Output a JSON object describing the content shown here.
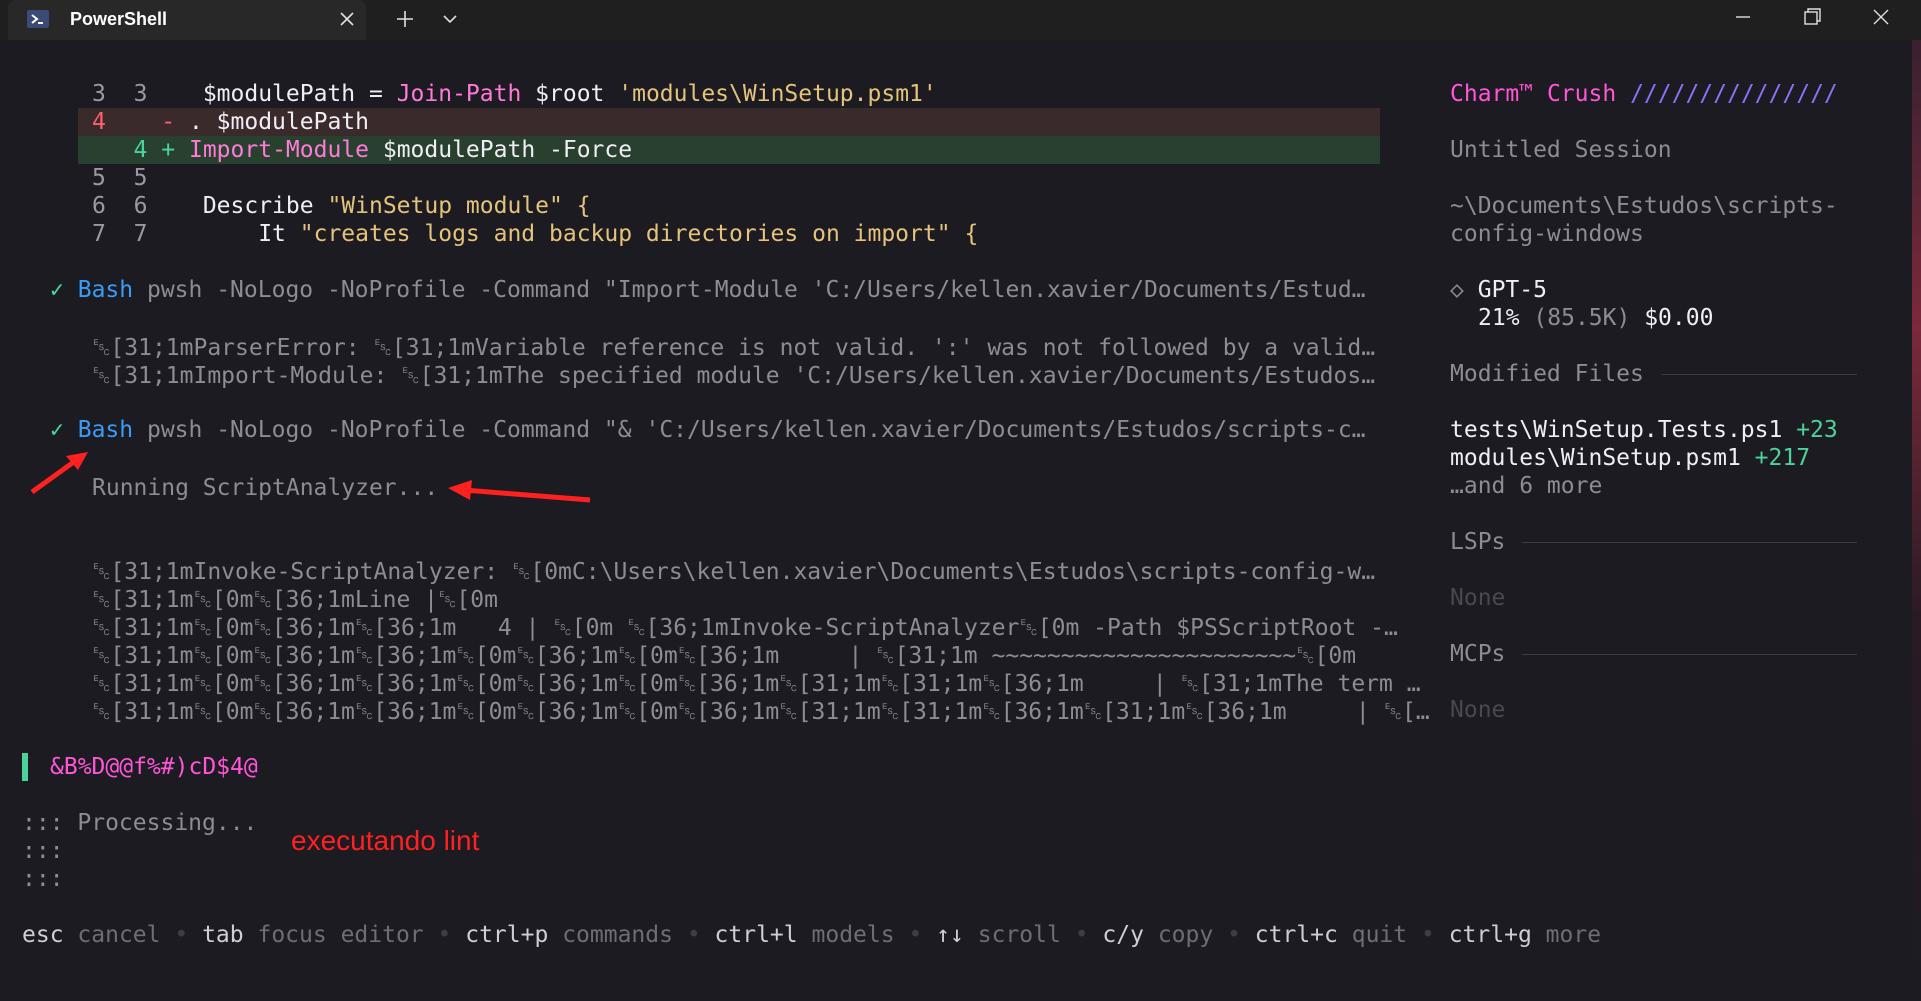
{
  "window": {
    "tab_title": "PowerShell",
    "icon": "powershell-icon"
  },
  "diff": {
    "rows": [
      {
        "old": "3",
        "new": "3",
        "marker": "",
        "code": "$modulePath = Join-Path $root 'modules\\WinSetup.psm1'"
      },
      {
        "old": "4",
        "new": "",
        "marker": "-",
        "code": ". $modulePath"
      },
      {
        "old": "",
        "new": "4",
        "marker": "+",
        "code": "Import-Module $modulePath -Force"
      },
      {
        "old": "5",
        "new": "5",
        "marker": "",
        "code": ""
      },
      {
        "old": "6",
        "new": "6",
        "marker": "",
        "code": "Describe \"WinSetup module\" {"
      },
      {
        "old": "7",
        "new": "7",
        "marker": "",
        "code": "    It \"creates logs and backup directories on import\" {"
      }
    ]
  },
  "tool1": {
    "check": "✓",
    "tool": "Bash",
    "command": "pwsh -NoLogo -NoProfile -Command \"Import-Module 'C:/Users/kellen.xavier/Documents/Estud…",
    "output": [
      "␛[31;1mParserError: ␛[31;1mVariable reference is not valid. ':' was not followed by a valid…",
      "␛[31;1mImport-Module: ␛[31;1mThe specified module 'C:/Users/kellen.xavier/Documents/Estudos…"
    ]
  },
  "tool2": {
    "check": "✓",
    "tool": "Bash",
    "command": "pwsh -NoLogo -NoProfile -Command \"& 'C:/Users/kellen.xavier/Documents/Estudos/scripts-c…",
    "output": [
      "Running ScriptAnalyzer...",
      "",
      "",
      "␛[31;1mInvoke-ScriptAnalyzer: ␛[0mC:\\Users\\kellen.xavier\\Documents\\Estudos\\scripts-config-w…",
      "␛[31;1m␛[0m␛[36;1mLine |␛[0m",
      "␛[31;1m␛[0m␛[36;1m␛[36;1m   4 | ␛[0m ␛[36;1mInvoke-ScriptAnalyzer␛[0m -Path $PSScriptRoot -…",
      "␛[31;1m␛[0m␛[36;1m␛[36;1m␛[0m␛[36;1m␛[0m␛[36;1m     | ␛[31;1m ~~~~~~~~~~~~~~~~~~~~~~␛[0m",
      "␛[31;1m␛[0m␛[36;1m␛[36;1m␛[0m␛[36;1m␛[0m␛[36;1m␛[31;1m␛[31;1m␛[36;1m     | ␛[31;1mThe term …",
      "␛[31;1m␛[0m␛[36;1m␛[36;1m␛[0m␛[36;1m␛[0m␛[36;1m␛[31;1m␛[31;1m␛[36;1m␛[31;1m␛[36;1m     | ␛[…"
    ]
  },
  "prompt": {
    "text": "&B%D@@f%#)cD$4@"
  },
  "processing": {
    "lines": [
      "::: Processing...",
      ":::",
      ":::"
    ],
    "annotation": "executando lint"
  },
  "help": [
    {
      "key": "esc",
      "desc": "cancel"
    },
    {
      "key": "tab",
      "desc": "focus editor"
    },
    {
      "key": "ctrl+p",
      "desc": "commands"
    },
    {
      "key": "ctrl+l",
      "desc": "models"
    },
    {
      "key": "↑↓",
      "desc": "scroll"
    },
    {
      "key": "c/y",
      "desc": "copy"
    },
    {
      "key": "ctrl+c",
      "desc": "quit"
    },
    {
      "key": "ctrl+g",
      "desc": "more"
    }
  ],
  "help_separator": "•",
  "sidebar": {
    "brand_charm": "Charm™",
    "brand_crush": "Crush",
    "brand_slashes": "///////////////",
    "session": "Untitled Session",
    "path_line1": "~\\Documents\\Estudos\\scripts-",
    "path_line2": "config-windows",
    "model_icon": "◇",
    "model": "GPT-5",
    "usage_pct": "21%",
    "usage_tokens": "(85.5K)",
    "usage_cost": "$0.00",
    "modified_title": "Modified Files",
    "files": [
      {
        "name": "tests\\WinSetup.Tests.ps1",
        "delta": "+23"
      },
      {
        "name": "modules\\WinSetup.psm1",
        "delta": "+217"
      }
    ],
    "more_files": "…and 6 more",
    "lsps_title": "LSPs",
    "lsps_value": "None",
    "mcps_title": "MCPs",
    "mcps_value": "None"
  },
  "colors": {
    "accent_green": "#49d49b",
    "accent_pink": "#ff55d7",
    "accent_violet": "#8e6ff9",
    "bash_blue": "#3a9cf7",
    "annotation_red": "#ff2020"
  }
}
